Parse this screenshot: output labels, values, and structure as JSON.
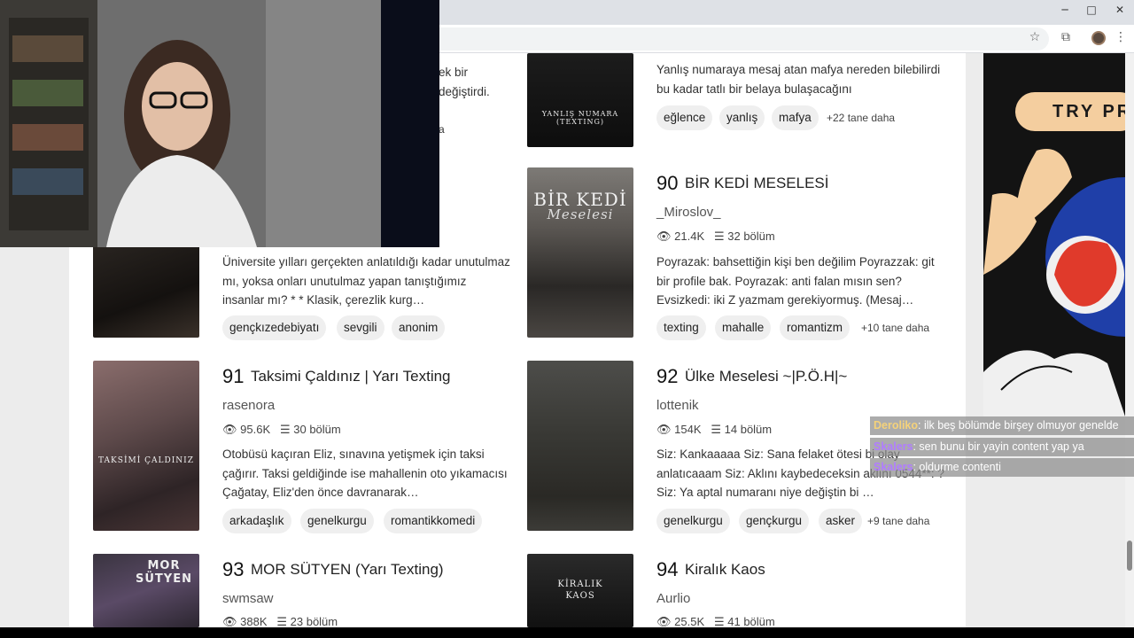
{
  "browser": {
    "window_controls": {
      "minimize": "─",
      "maximize": "□",
      "close": "✕"
    },
    "toolbar_icons": [
      "star-icon",
      "extensions-icon",
      "menu-icon"
    ]
  },
  "partial_card": {
    "desc": [
      "ek bir",
      "değiştirdi.",
      "a"
    ]
  },
  "stories": [
    {
      "number": "",
      "title": "",
      "author": "",
      "views": "",
      "parts": "",
      "cover_text": "",
      "desc": "Üniversite yılları gerçekten anlatıldığı kadar unutulmaz mı, yoksa onları unutulmaz yapan tanıştığımız insanlar mı? * * Klasik, çerezlik kurg…",
      "tags": [
        "gençkızedebiyatı",
        "sevgili",
        "anonim"
      ],
      "more": ""
    },
    {
      "number": "",
      "title": "",
      "author": "",
      "views": "",
      "parts": "",
      "cover_text": "YANLIŞ NUMARA (TEXTING)",
      "desc": "Yanlış numaraya mesaj atan mafya nereden bilebilirdi bu kadar tatlı bir belaya bulaşacağını",
      "tags": [
        "eğlence",
        "yanlış",
        "mafya"
      ],
      "more": "+22 tane daha"
    },
    {
      "number": "90",
      "title": "BİR KEDİ MESELESİ",
      "author": "_Miroslov_",
      "views": "21.4K",
      "parts": "32 bölüm",
      "cover_text": "BİR KEDİ",
      "cover_sub": "Meselesi",
      "desc": "Poyrazak: bahsettiğin kişi ben değilim Poyrazzak: git bir profile bak. Poyrazak: anti falan mısın sen? Evsizkedi: iki Z yazmam gerekiyormuş. (Mesaj…",
      "tags": [
        "texting",
        "mahalle",
        "romantizm"
      ],
      "more": "+10 tane daha"
    },
    {
      "number": "91",
      "title": "Taksimi Çaldınız | Yarı Texting",
      "author": "rasenora",
      "views": "95.6K",
      "parts": "30 bölüm",
      "cover_text": "TAKSİMİ ÇALDINIZ",
      "desc": "Otobüsü kaçıran Eliz, sınavına yetişmek için taksi çağırır. Taksi geldiğinde ise mahallenin oto yıkamacısı Çağatay, Eliz'den önce davranarak…",
      "tags": [
        "arkadaşlık",
        "genelkurgu",
        "romantikkomedi"
      ],
      "more": ""
    },
    {
      "number": "92",
      "title": "Ülke Meselesi ~|P.Ö.H|~",
      "author": "lottenik",
      "views": "154K",
      "parts": "14 bölüm",
      "cover_text": "",
      "desc": "Siz: Kankaaaaa Siz: Sana felaket ötesi bi olay anlatıcaaam Siz: Aklını kaybedeceksin aklını 0544**: ? Siz: Ya aptal numaranı niye değiştin bi …",
      "tags": [
        "genelkurgu",
        "gençkurgu",
        "asker"
      ],
      "more": "+9 tane daha"
    },
    {
      "number": "93",
      "title": "MOR SÜTYEN (Yarı Texting)",
      "author": "swmsaw",
      "views": "388K",
      "parts": "23 bölüm",
      "cover_text": "MOR SÜTYEN",
      "desc": "",
      "tags": [],
      "more": ""
    },
    {
      "number": "94",
      "title": "Kiralık Kaos",
      "author": "Aurlio",
      "views": "25.5K",
      "parts": "41 bölüm",
      "cover_text": "KİRALIK KAOS",
      "desc": "",
      "tags": [],
      "more": ""
    }
  ],
  "ad": {
    "button": "TRY PR"
  },
  "chat": [
    {
      "user": "Deroliko",
      "color": "#f5d27a",
      "text": ": ilk beş bölümde birşey olmuyor genelde"
    },
    {
      "user": "Skalers",
      "color": "#b07cff",
      "text": ": sen bunu bir yayin content yap ya"
    },
    {
      "user": "Skalers",
      "color": "#b07cff",
      "text": ": oldurme contenti"
    }
  ],
  "colors": {
    "accent_ad": "#f4ce9f",
    "chat_bg": "#8c8c8c"
  }
}
